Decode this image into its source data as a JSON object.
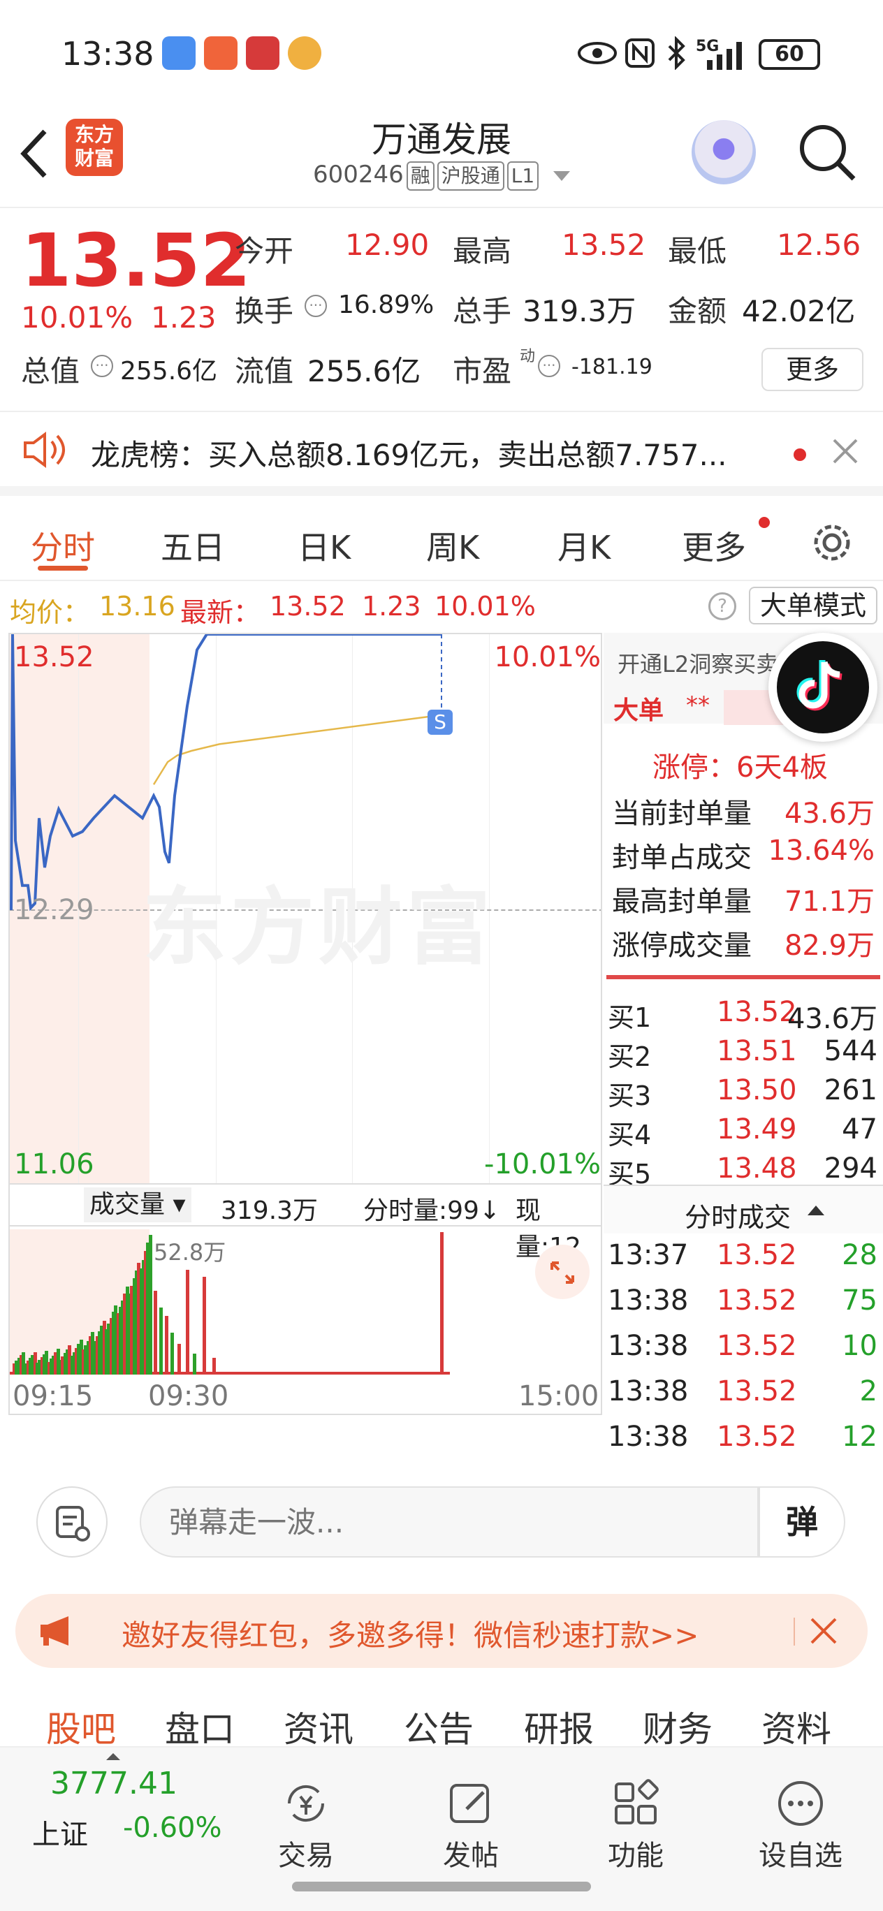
{
  "status": {
    "time": "13:38",
    "network": "5G",
    "battery": "60"
  },
  "header": {
    "title": "万通发展",
    "code": "600246",
    "tags": [
      "融",
      "沪股通",
      "L1"
    ],
    "logo_lines": [
      "东方",
      "财富"
    ]
  },
  "quote": {
    "price": "13.52",
    "change_pct": "10.01%",
    "change": "1.23",
    "open_label": "今开",
    "open": "12.90",
    "high_label": "最高",
    "high": "13.52",
    "low_label": "最低",
    "low": "12.56",
    "turnover_label": "换手",
    "turnover": "16.89%",
    "volume_label": "总手",
    "volume": "319.3万",
    "amount_label": "金额",
    "amount": "42.02亿",
    "mktcap_label": "总值",
    "mktcap": "255.6亿",
    "float_label": "流值",
    "float": "255.6亿",
    "pe_label": "市盈",
    "pe_sup": "动",
    "pe": "-181.19",
    "more": "更多"
  },
  "notice": {
    "text": "龙虎榜：买入总额8.169亿元，卖出总额7.757..."
  },
  "tabs": [
    "分时",
    "五日",
    "日K",
    "周K",
    "月K",
    "更多"
  ],
  "avg": {
    "avg_label": "均价：",
    "avg": "13.16",
    "latest_label": "最新：",
    "latest": "13.52",
    "chg": "1.23",
    "pct": "10.01%",
    "mode": "大单模式"
  },
  "chart": {
    "top_price": "13.52",
    "top_pct": "10.01%",
    "mid_price": "12.29",
    "bottom_price": "11.06",
    "bottom_pct": "-10.01%",
    "watermark": "东方财富",
    "s_marker": "S",
    "vol_label": "成交量",
    "vol_total": "319.3万",
    "vol_max": "52.8万",
    "fen_label": "分时量:99↓",
    "now_label": "现量:12",
    "times": [
      "09:15",
      "09:30",
      "15:00"
    ]
  },
  "chart_data": {
    "type": "line",
    "x_range": [
      "09:15",
      "15:00"
    ],
    "y_range": [
      11.06,
      13.52
    ],
    "prev_close": 12.29,
    "price_series": [
      12.29,
      13.52,
      12.6,
      12.4,
      12.4,
      12.3,
      12.32,
      12.7,
      12.48,
      12.62,
      12.74,
      12.62,
      12.64,
      12.7,
      12.8,
      12.75,
      12.7,
      12.8,
      12.75,
      12.55,
      12.5,
      12.8,
      13.2,
      13.45,
      13.52,
      13.52,
      13.52,
      13.52
    ],
    "avg_series": [
      12.85,
      12.9,
      12.95,
      12.98,
      13.0,
      13.03,
      13.16
    ]
  },
  "l2": {
    "title": "开通L2洞察买卖",
    "big": "大单",
    "stars": "**",
    "limit": "涨停：6天4板",
    "rows": [
      {
        "label": "当前封单量",
        "value": "43.6万"
      },
      {
        "label": "封单占成交",
        "value": "13.64%"
      },
      {
        "label": "最高封单量",
        "value": "71.1万"
      },
      {
        "label": "涨停成交量",
        "value": "82.9万"
      }
    ]
  },
  "bids": [
    {
      "label": "买1",
      "price": "13.52",
      "qty": "43.6万"
    },
    {
      "label": "买2",
      "price": "13.51",
      "qty": "544"
    },
    {
      "label": "买3",
      "price": "13.50",
      "qty": "261"
    },
    {
      "label": "买4",
      "price": "13.49",
      "qty": "47"
    },
    {
      "label": "买5",
      "price": "13.48",
      "qty": "294"
    }
  ],
  "trades_title": "分时成交",
  "trades": [
    {
      "time": "13:37",
      "price": "13.52",
      "qty": "28"
    },
    {
      "time": "13:38",
      "price": "13.52",
      "qty": "75"
    },
    {
      "time": "13:38",
      "price": "13.52",
      "qty": "10"
    },
    {
      "time": "13:38",
      "price": "13.52",
      "qty": "2"
    },
    {
      "time": "13:38",
      "price": "13.52",
      "qty": "12"
    }
  ],
  "danmu": {
    "placeholder": "弹幕走一波...",
    "btn": "弹"
  },
  "promo": {
    "text": "邀好友得红包，多邀多得！微信秒速打款>>"
  },
  "bottom_tabs": [
    "股吧",
    "盘口",
    "资讯",
    "公告",
    "研报",
    "财务",
    "资料"
  ],
  "nav": {
    "index_value": "3777.41",
    "index_name": "上证",
    "index_pct": "-0.60%",
    "items": [
      "交易",
      "发帖",
      "功能",
      "设自选"
    ]
  },
  "colors": {
    "up": "#e02d2d",
    "down": "#24a02a",
    "accent": "#e0572d",
    "line": "#3a67c4",
    "avg": "#e5b84a"
  }
}
